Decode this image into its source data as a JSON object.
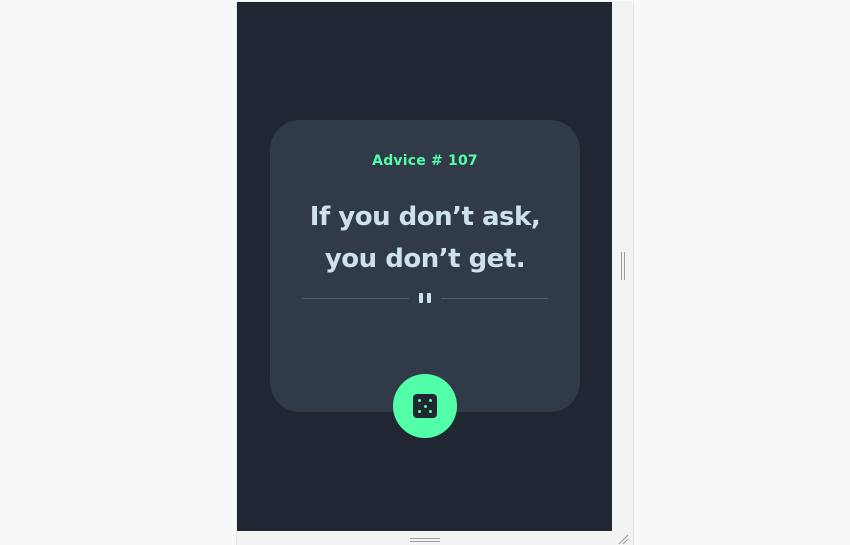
{
  "advice": {
    "id_label": "Advice # 107",
    "quote": "If you don’t ask, you don’t get."
  },
  "controls": {
    "generate_icon": "dice-icon",
    "divider_icon": "pause-icon"
  },
  "colors": {
    "page_bg": "#202632",
    "card_bg": "#313a49",
    "accent": "#52ffa8",
    "quote_text": "#cee3e9",
    "divider": "#4f5d74"
  }
}
